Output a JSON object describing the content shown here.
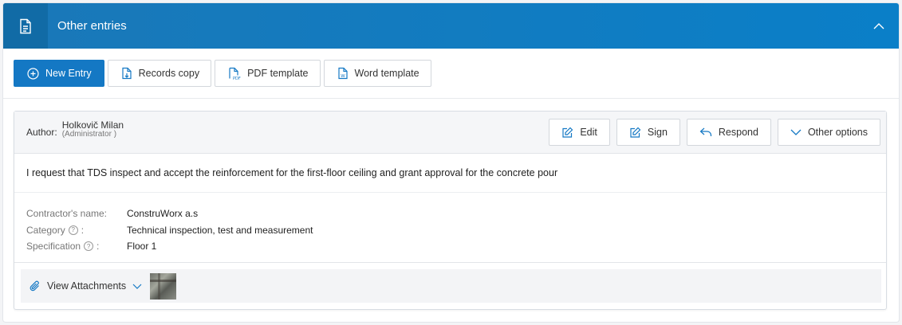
{
  "panel": {
    "title": "Other entries",
    "header_icon": "document-icon",
    "collapse_icon": "chevron-up-icon"
  },
  "toolbar": {
    "new_entry": "New Entry",
    "records_copy": "Records copy",
    "pdf_template": "PDF template",
    "word_template": "Word template"
  },
  "entry": {
    "author_label": "Author:",
    "author_name": "Holkovič Milan",
    "author_role": "(Administrator )",
    "actions": {
      "edit": "Edit",
      "sign": "Sign",
      "respond": "Respond",
      "other_options": "Other options"
    },
    "text": "I request that TDS inspect and accept the reinforcement for the first-floor ceiling and grant approval for the concrete pour",
    "details": [
      {
        "label": "Contractor's name:",
        "value": "ConstruWorx a.s",
        "help": false
      },
      {
        "label": "Category",
        "suffix": ":",
        "value": "Technical inspection, test and measurement",
        "help": true
      },
      {
        "label": "Specification",
        "suffix": ":",
        "value": "Floor 1",
        "help": true
      }
    ],
    "attachments_label": "View Attachments"
  },
  "colors": {
    "header": "#0a7fc8",
    "primary_button": "#1478c4"
  }
}
